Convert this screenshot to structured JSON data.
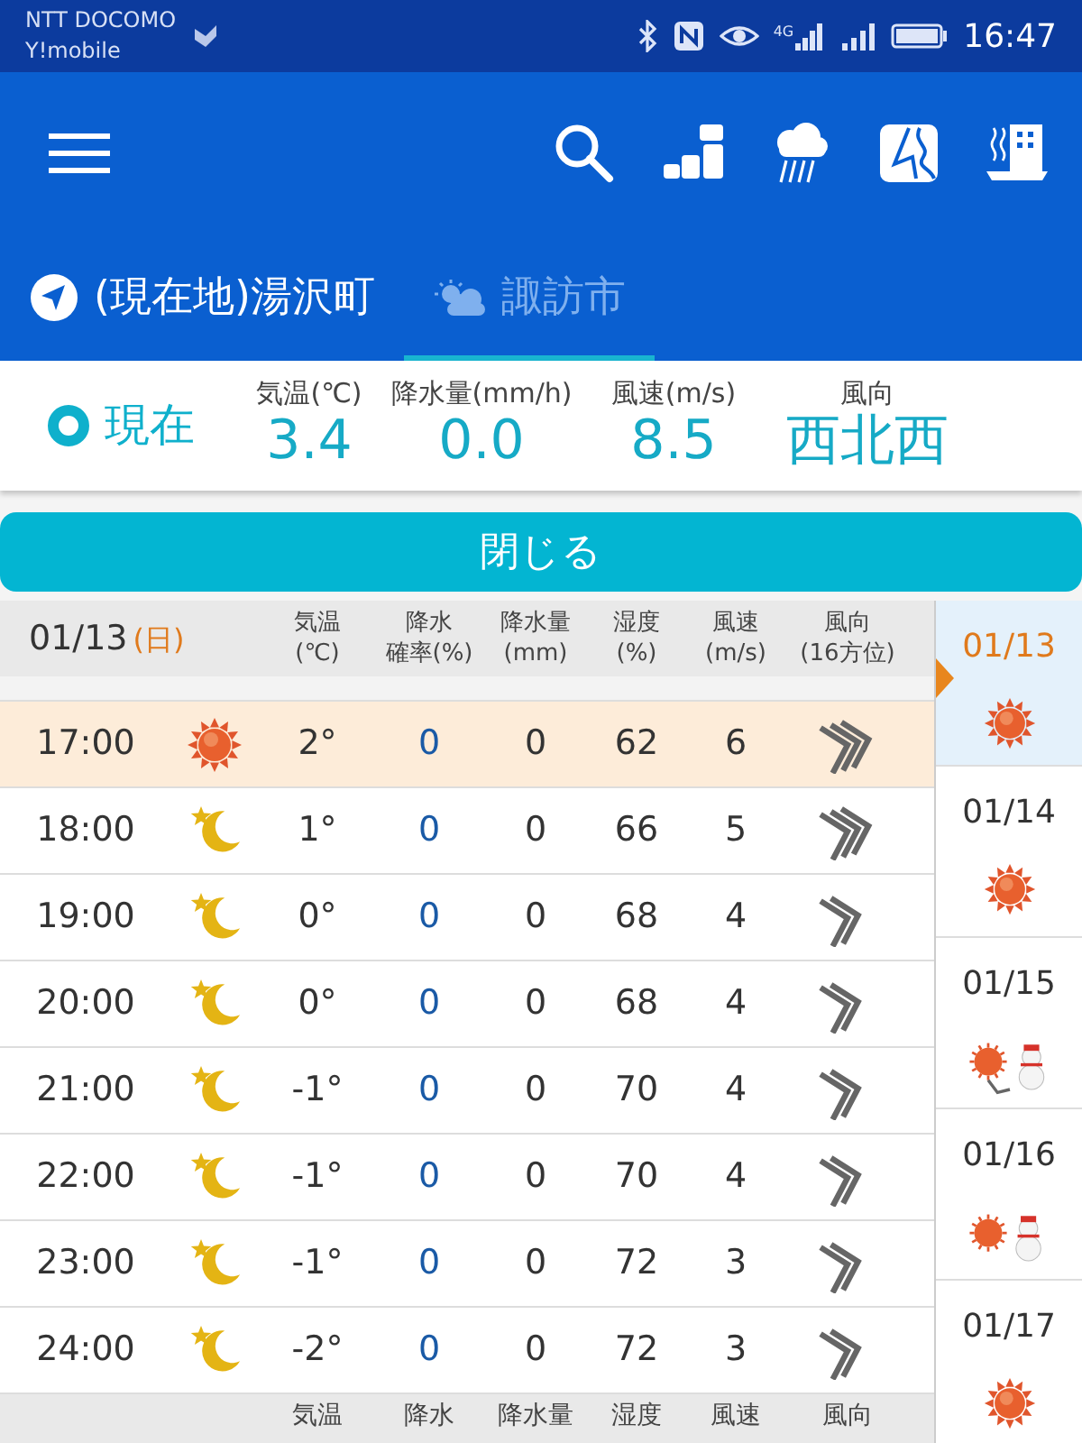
{
  "status_bar": {
    "carriers": [
      "NTT DOCOMO",
      "Y!mobile"
    ],
    "network": "4G",
    "time": "16:47"
  },
  "toolbar": {
    "actions": [
      {
        "kind": "search"
      },
      {
        "kind": "blocks"
      },
      {
        "kind": "rain"
      },
      {
        "kind": "map"
      },
      {
        "kind": "building"
      }
    ]
  },
  "tabs": [
    {
      "label": "(現在地)湯沢町",
      "kind": "location",
      "selected": true,
      "underlined": false
    },
    {
      "label": "諏訪市",
      "kind": "weather",
      "selected": false,
      "underlined": true
    }
  ],
  "current": {
    "label": "現在",
    "metrics": [
      {
        "label": "気温(℃)",
        "value": "3.4"
      },
      {
        "label": "降水量(mm/h)",
        "value": "0.0"
      },
      {
        "label": "風速(m/s)",
        "value": "8.5"
      },
      {
        "label": "風向",
        "value": "西北西"
      }
    ]
  },
  "close_button": "閉じる",
  "table": {
    "date": "01/13",
    "weekday": "(日)",
    "columns": [
      [
        "気温",
        "(℃)"
      ],
      [
        "降水",
        "確率(%)"
      ],
      [
        "降水量",
        "(mm)"
      ],
      [
        "湿度",
        "(%)"
      ],
      [
        "風速",
        "(m/s)"
      ],
      [
        "風向",
        "(16方位)"
      ]
    ],
    "rows": [
      {
        "time": "17:00",
        "weather": {
          "kind": "sun"
        },
        "temp": "2°",
        "prob": "0",
        "amount": "0",
        "humidity": "62",
        "wind": "6",
        "direction": {
          "kind": "triple"
        },
        "current": true
      },
      {
        "time": "18:00",
        "weather": {
          "kind": "moon"
        },
        "temp": "1°",
        "prob": "0",
        "amount": "0",
        "humidity": "66",
        "wind": "5",
        "direction": {
          "kind": "triple"
        },
        "current": false
      },
      {
        "time": "19:00",
        "weather": {
          "kind": "moon"
        },
        "temp": "0°",
        "prob": "0",
        "amount": "0",
        "humidity": "68",
        "wind": "4",
        "direction": {
          "kind": "double"
        },
        "current": false
      },
      {
        "time": "20:00",
        "weather": {
          "kind": "moon"
        },
        "temp": "0°",
        "prob": "0",
        "amount": "0",
        "humidity": "68",
        "wind": "4",
        "direction": {
          "kind": "double"
        },
        "current": false
      },
      {
        "time": "21:00",
        "weather": {
          "kind": "moon"
        },
        "temp": "-1°",
        "prob": "0",
        "amount": "0",
        "humidity": "70",
        "wind": "4",
        "direction": {
          "kind": "double"
        },
        "current": false
      },
      {
        "time": "22:00",
        "weather": {
          "kind": "moon"
        },
        "temp": "-1°",
        "prob": "0",
        "amount": "0",
        "humidity": "70",
        "wind": "4",
        "direction": {
          "kind": "double"
        },
        "current": false
      },
      {
        "time": "23:00",
        "weather": {
          "kind": "moon"
        },
        "temp": "-1°",
        "prob": "0",
        "amount": "0",
        "humidity": "72",
        "wind": "3",
        "direction": {
          "kind": "double"
        },
        "current": false
      },
      {
        "time": "24:00",
        "weather": {
          "kind": "moon"
        },
        "temp": "-2°",
        "prob": "0",
        "amount": "0",
        "humidity": "72",
        "wind": "3",
        "direction": {
          "kind": "double"
        },
        "current": false
      }
    ],
    "next_header": {
      "labels": [
        "気温",
        "降水",
        "降水量",
        "湿度",
        "風速",
        "風向"
      ]
    }
  },
  "days": [
    {
      "date": "01/13",
      "weather": {
        "kind": "sun"
      },
      "selected": true
    },
    {
      "date": "01/14",
      "weather": {
        "kind": "sun"
      },
      "selected": false
    },
    {
      "date": "01/15",
      "weather": {
        "kind": "sun-to-snow"
      },
      "selected": false
    },
    {
      "date": "01/16",
      "weather": {
        "kind": "sun-snow"
      },
      "selected": false
    },
    {
      "date": "01/17",
      "weather": {
        "kind": "sun"
      },
      "selected": false
    }
  ]
}
